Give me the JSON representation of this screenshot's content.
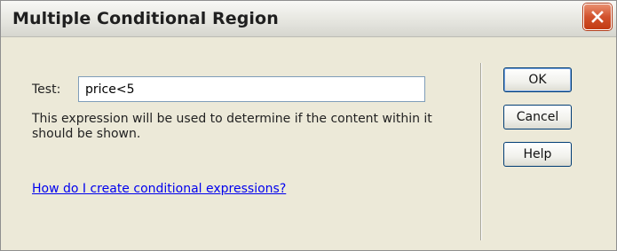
{
  "window": {
    "title": "Multiple Conditional Region"
  },
  "form": {
    "test_label": "Test:",
    "test_value": "price<5",
    "description": "This expression will be used to determine if the content within it should be shown.",
    "help_link": "How do I create conditional expressions?"
  },
  "buttons": {
    "ok": "OK",
    "cancel": "Cancel",
    "help": "Help"
  },
  "icons": {
    "close": "close-icon"
  },
  "colors": {
    "close_button": "#d2522d",
    "link": "#0000ee",
    "dialog_background": "#ece9d8"
  }
}
